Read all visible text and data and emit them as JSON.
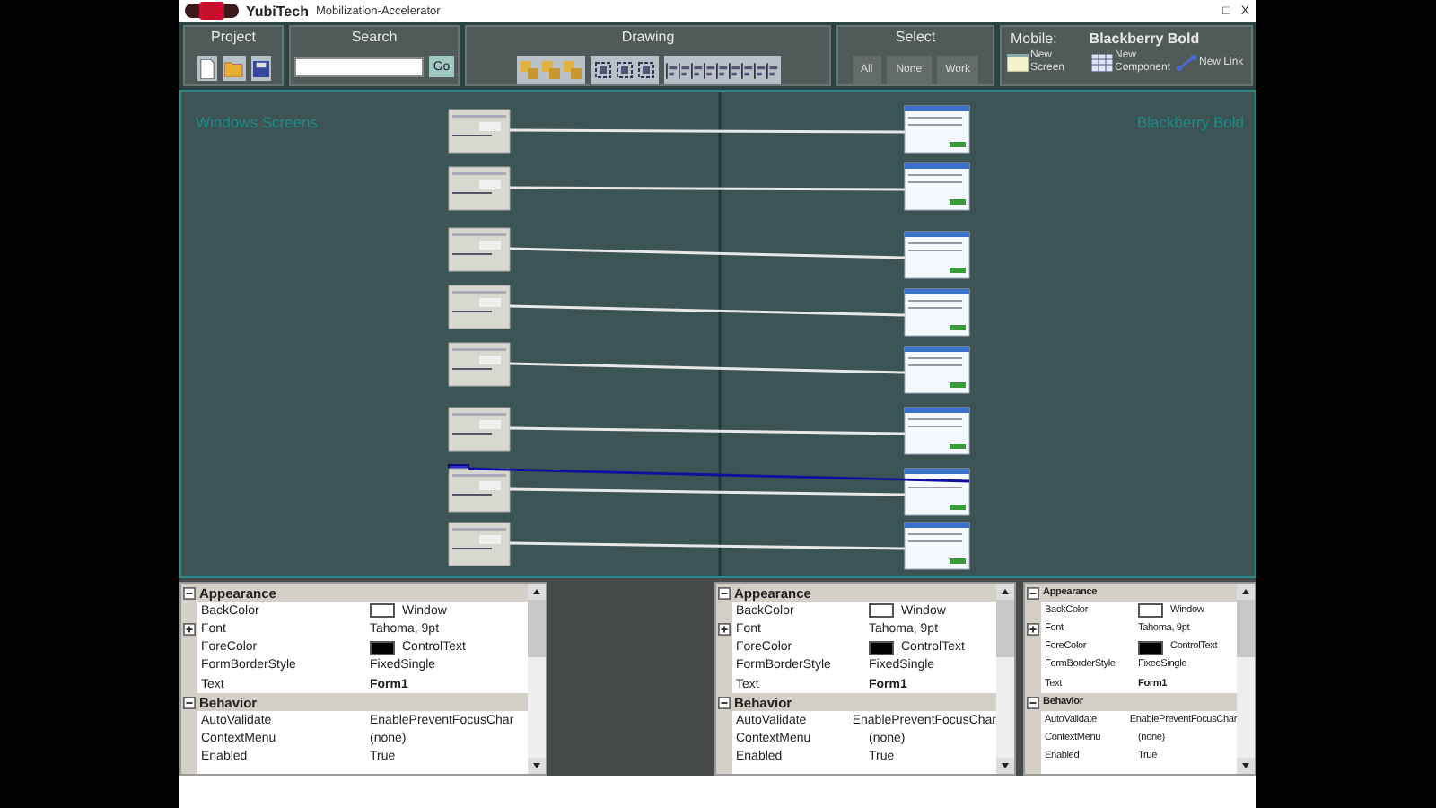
{
  "window": {
    "brand": "YubiTech",
    "subtitle": "Mobilization-Accelerator",
    "controls": [
      "□",
      "X"
    ]
  },
  "toolbar": {
    "project": {
      "title": "Project"
    },
    "search": {
      "title": "Search",
      "button": "Go"
    },
    "drawing": {
      "title": "Drawing"
    },
    "select": {
      "title": "Select",
      "buttons": [
        "All",
        "None",
        "Work"
      ]
    },
    "mobile": {
      "label": "Mobile:",
      "device": "Blackberry Bold",
      "actions": [
        {
          "kind": "screen",
          "label": "New Screen"
        },
        {
          "kind": "component",
          "label": "New Component"
        },
        {
          "kind": "link",
          "label": "New Link"
        }
      ]
    }
  },
  "canvas": {
    "left_label": "Windows Screens",
    "right_label": "Blackberry Bold",
    "mappings": [
      {
        "selected": false
      },
      {
        "selected": false
      },
      {
        "selected": false
      },
      {
        "selected": false
      },
      {
        "selected": false
      },
      {
        "selected": false
      },
      {
        "selected": true
      },
      {
        "selected": false
      }
    ]
  },
  "property_grids": [
    {
      "categories": [
        {
          "name": "Appearance",
          "expanded": true,
          "rows": [
            {
              "kind": "color",
              "name": "BackColor",
              "value": "Window",
              "color": "#ffffff"
            },
            {
              "kind": "expandable",
              "name": "Font",
              "value": "Tahoma, 9pt"
            },
            {
              "kind": "color",
              "name": "ForeColor",
              "value": "ControlText",
              "color": "#000000"
            },
            {
              "kind": "plain",
              "name": "FormBorderStyle",
              "value": "FixedSingle"
            },
            {
              "kind": "strong",
              "name": "Text",
              "value": "Form1"
            }
          ]
        },
        {
          "name": "Behavior",
          "expanded": true,
          "rows": [
            {
              "kind": "plain",
              "name": "AutoValidate",
              "value": "EnablePreventFocusChar"
            },
            {
              "kind": "plain",
              "name": "ContextMenu",
              "value": "(none)"
            },
            {
              "kind": "plain",
              "name": "Enabled",
              "value": "True"
            }
          ]
        }
      ]
    },
    {
      "categories": [
        {
          "name": "Appearance",
          "expanded": true,
          "rows": [
            {
              "kind": "color",
              "name": "BackColor",
              "value": "Window",
              "color": "#ffffff"
            },
            {
              "kind": "expandable",
              "name": "Font",
              "value": "Tahoma, 9pt"
            },
            {
              "kind": "color",
              "name": "ForeColor",
              "value": "ControlText",
              "color": "#000000"
            },
            {
              "kind": "plain",
              "name": "FormBorderStyle",
              "value": "FixedSingle"
            },
            {
              "kind": "strong",
              "name": "Text",
              "value": "Form1"
            }
          ]
        },
        {
          "name": "Behavior",
          "expanded": true,
          "rows": [
            {
              "kind": "plain",
              "name": "AutoValidate",
              "value": "EnablePreventFocusChar"
            },
            {
              "kind": "plain",
              "name": "ContextMenu",
              "value": "(none)"
            },
            {
              "kind": "plain",
              "name": "Enabled",
              "value": "True"
            }
          ]
        }
      ]
    },
    {
      "categories": [
        {
          "name": "Appearance",
          "expanded": true,
          "rows": [
            {
              "kind": "color",
              "name": "BackColor",
              "value": "Window",
              "color": "#ffffff"
            },
            {
              "kind": "expandable",
              "name": "Font",
              "value": "Tahoma, 9pt"
            },
            {
              "kind": "color",
              "name": "ForeColor",
              "value": "ControlText",
              "color": "#000000"
            },
            {
              "kind": "plain",
              "name": "FormBorderStyle",
              "value": "FixedSingle"
            },
            {
              "kind": "strong",
              "name": "Text",
              "value": "Form1"
            }
          ]
        },
        {
          "name": "Behavior",
          "expanded": true,
          "rows": [
            {
              "kind": "plain",
              "name": "AutoValidate",
              "value": "EnablePreventFocusChar"
            },
            {
              "kind": "plain",
              "name": "ContextMenu",
              "value": "(none)"
            },
            {
              "kind": "plain",
              "name": "Enabled",
              "value": "True"
            }
          ]
        }
      ]
    }
  ]
}
